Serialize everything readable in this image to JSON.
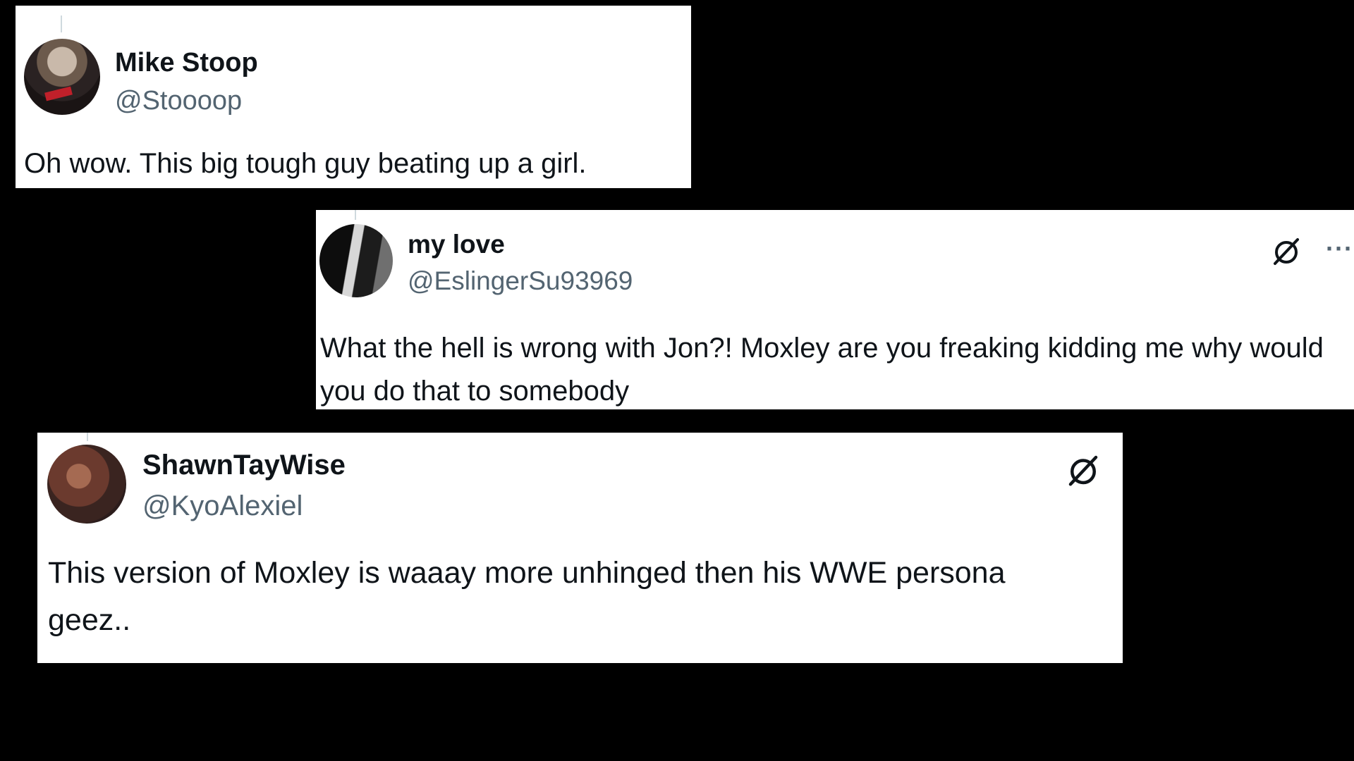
{
  "colors": {
    "background": "#000000",
    "card": "#ffffff",
    "name": "#0f1419",
    "handle": "#536471",
    "thread_line": "#cfd9de"
  },
  "tweets": [
    {
      "display_name": "Mike Stoop",
      "handle": "@Stoooop",
      "text": "Oh wow. This big tough guy beating up a girl.",
      "avatar_icon": "avatar"
    },
    {
      "display_name": "my love",
      "handle": "@EslingerSu93969",
      "text": "What the hell is wrong with Jon?! Moxley are you freaking kidding me why would you do that to somebody",
      "grok_icon": "grok-icon",
      "more_icon": "more-icon",
      "more_glyph": "···"
    },
    {
      "display_name": "ShawnTayWise",
      "handle": "@KyoAlexiel",
      "text": "This version of Moxley is waaay more unhinged then his WWE persona geez..",
      "grok_icon": "grok-icon"
    }
  ]
}
